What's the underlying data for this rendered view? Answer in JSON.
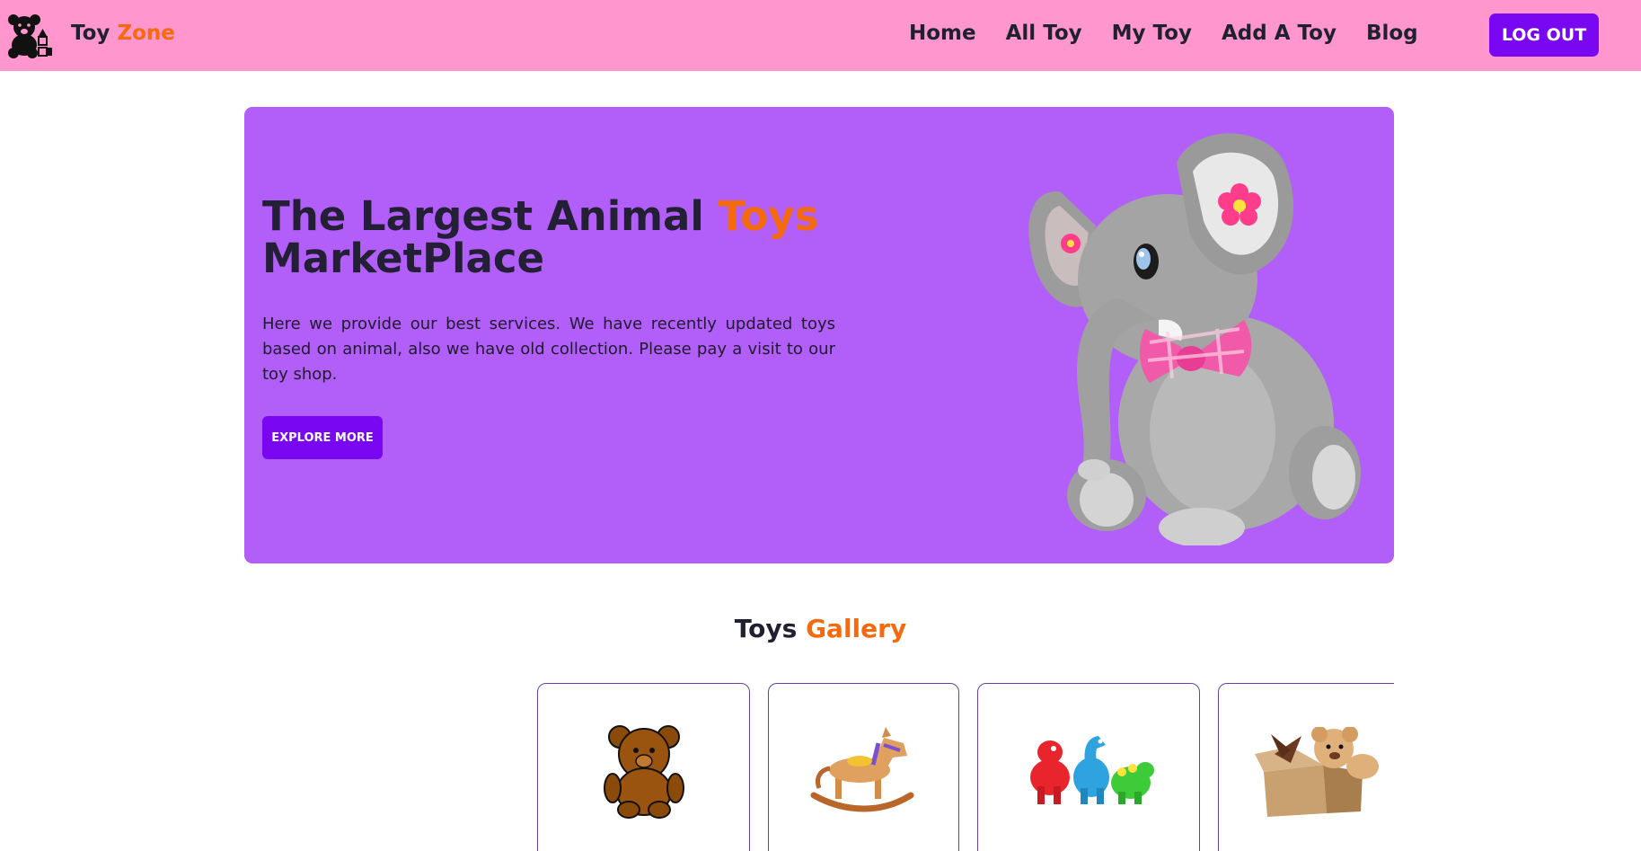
{
  "header": {
    "logo_icon": "teddy-bear-blocks-icon",
    "brand_primary": "Toy",
    "brand_accent": "Zone",
    "nav": [
      "Home",
      "All Toy",
      "My Toy",
      "Add A Toy",
      "Blog"
    ],
    "logout_label": "LOG OUT"
  },
  "hero": {
    "title_part1": "The Largest Animal ",
    "title_accent": "Toys",
    "title_part2": "MarketPlace",
    "description": "Here we provide our best services. We have recently updated toys based on animal, also we have old collection. Please pay a visit to our toy shop.",
    "button_label": "EXPLORE MORE",
    "image": "plush-elephant-with-pink-bow"
  },
  "gallery": {
    "title_primary": "Toys",
    "title_accent": "Gallery",
    "items": [
      "teddy-bear-icon",
      "rocking-horse-icon",
      "toy-dinosaurs-image",
      "teddy-in-box-image"
    ]
  },
  "colors": {
    "navbar_bg": "#ff96cd",
    "accent_orange": "#f56a0c",
    "button_purple": "#7a07f2",
    "hero_bg": "#b25ff9"
  }
}
